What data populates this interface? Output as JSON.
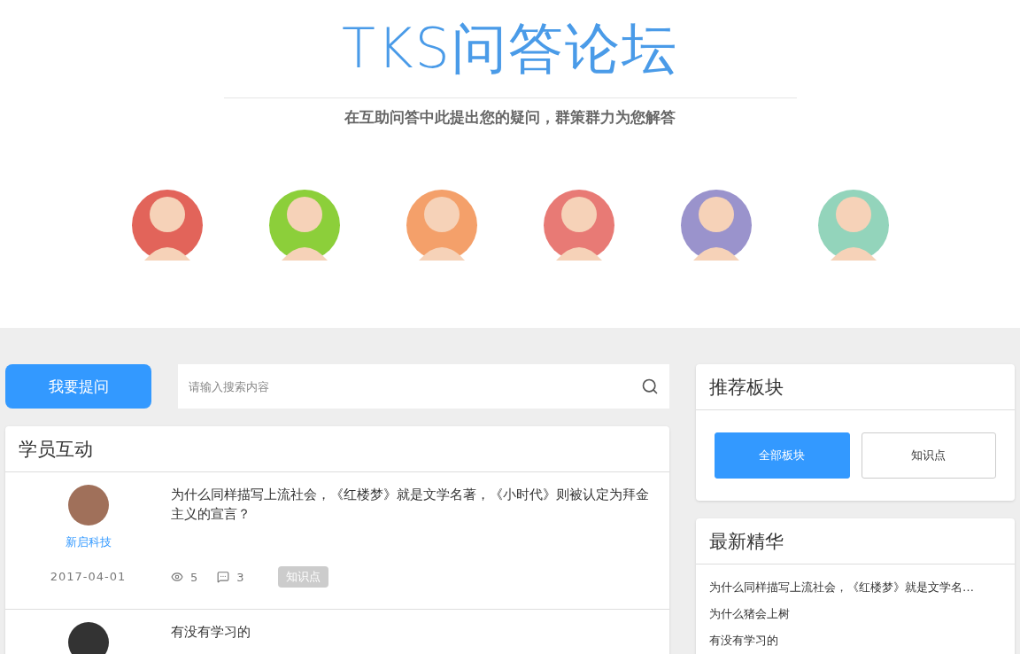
{
  "header": {
    "title": "TKS问答论坛",
    "subtitle": "在互助问答中此提出您的疑问，群策群力为您解答"
  },
  "avatars": [
    {
      "color": "#e2645a"
    },
    {
      "color": "#8ccf3a"
    },
    {
      "color": "#f4a06a"
    },
    {
      "color": "#e87a75"
    },
    {
      "color": "#9a93cc"
    },
    {
      "color": "#93d4bb"
    }
  ],
  "ask_button": "我要提问",
  "search": {
    "placeholder": "请输入搜索内容"
  },
  "posts_panel": {
    "title": "学员互动",
    "posts": [
      {
        "author": "新启科技",
        "date": "2017-04-01",
        "title": "为什么同样描写上流社会，《红楼梦》就是文学名著，《小时代》则被认定为拜金主义的宣言？",
        "views": "5",
        "comments": "3",
        "tag": "知识点"
      },
      {
        "title": "有没有学习的"
      }
    ]
  },
  "boards_panel": {
    "title": "推荐板块",
    "boards": [
      {
        "label": "全部板块",
        "selected": true
      },
      {
        "label": "知识点",
        "selected": false
      }
    ]
  },
  "featured_panel": {
    "title": "最新精华",
    "items": [
      "为什么同样描写上流社会，《红楼梦》就是文学名…",
      "为什么猪会上树",
      "有没有学习的"
    ]
  }
}
